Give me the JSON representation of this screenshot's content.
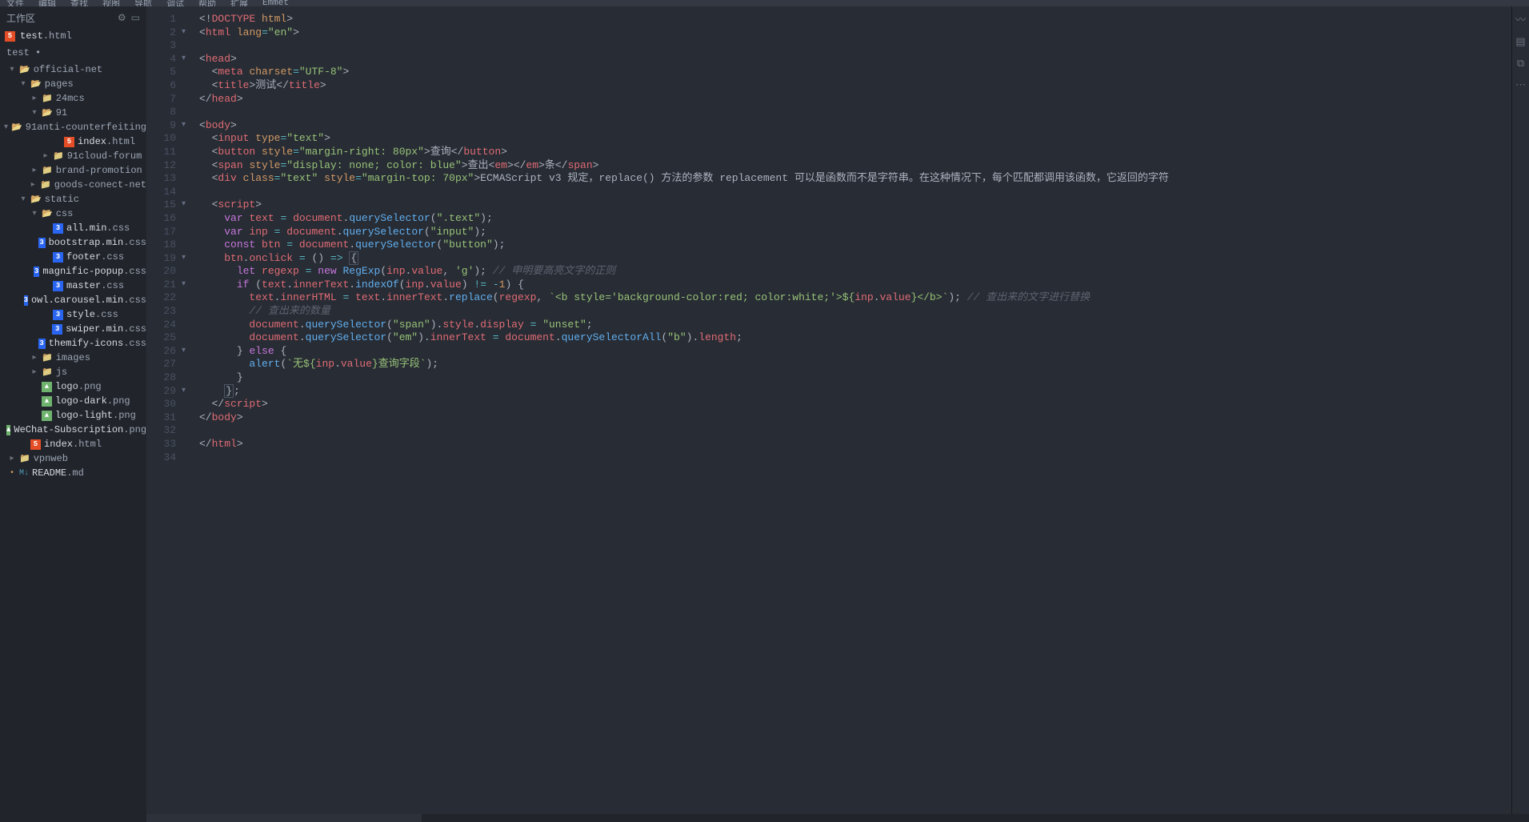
{
  "menubar": [
    "文件",
    "编辑",
    "查找",
    "视图",
    "导航",
    "调试",
    "帮助",
    "扩展",
    "Emmet"
  ],
  "sidebar": {
    "title": "工作区",
    "open_file": {
      "name": "test",
      "ext": ".html"
    },
    "project_root": "test •",
    "tree": [
      {
        "type": "folder",
        "open": true,
        "depth": 0,
        "label": "official-net"
      },
      {
        "type": "folder",
        "open": true,
        "depth": 1,
        "label": "pages"
      },
      {
        "type": "folder",
        "open": false,
        "depth": 2,
        "label": "24mcs"
      },
      {
        "type": "folder",
        "open": true,
        "depth": 2,
        "label": "91"
      },
      {
        "type": "folder",
        "open": true,
        "depth": 3,
        "label": "91anti-counterfeiting"
      },
      {
        "type": "file",
        "icon": "html",
        "depth": 4,
        "label": "index",
        "ext": ".html"
      },
      {
        "type": "folder",
        "open": false,
        "depth": 3,
        "label": "91cloud-forum"
      },
      {
        "type": "folder",
        "open": false,
        "depth": 2,
        "label": "brand-promotion"
      },
      {
        "type": "folder",
        "open": false,
        "depth": 2,
        "label": "goods-conect-net"
      },
      {
        "type": "folder",
        "open": true,
        "depth": 1,
        "label": "static"
      },
      {
        "type": "folder",
        "open": true,
        "depth": 2,
        "label": "css"
      },
      {
        "type": "file",
        "icon": "css",
        "depth": 3,
        "label": "all.min",
        "ext": ".css"
      },
      {
        "type": "file",
        "icon": "css",
        "depth": 3,
        "label": "bootstrap.min",
        "ext": ".css"
      },
      {
        "type": "file",
        "icon": "css",
        "depth": 3,
        "label": "footer",
        "ext": ".css"
      },
      {
        "type": "file",
        "icon": "css",
        "depth": 3,
        "label": "magnific-popup",
        "ext": ".css"
      },
      {
        "type": "file",
        "icon": "css",
        "depth": 3,
        "label": "master",
        "ext": ".css"
      },
      {
        "type": "file",
        "icon": "css",
        "depth": 3,
        "label": "owl.carousel.min",
        "ext": ".css"
      },
      {
        "type": "file",
        "icon": "css",
        "depth": 3,
        "label": "style",
        "ext": ".css"
      },
      {
        "type": "file",
        "icon": "css",
        "depth": 3,
        "label": "swiper.min",
        "ext": ".css"
      },
      {
        "type": "file",
        "icon": "css",
        "depth": 3,
        "label": "themify-icons",
        "ext": ".css"
      },
      {
        "type": "folder",
        "open": false,
        "depth": 2,
        "label": "images"
      },
      {
        "type": "folder",
        "open": false,
        "depth": 2,
        "label": "js"
      },
      {
        "type": "file",
        "icon": "img",
        "depth": 2,
        "label": "logo",
        "ext": ".png"
      },
      {
        "type": "file",
        "icon": "img",
        "depth": 2,
        "label": "logo-dark",
        "ext": ".png"
      },
      {
        "type": "file",
        "icon": "img",
        "depth": 2,
        "label": "logo-light",
        "ext": ".png"
      },
      {
        "type": "file",
        "icon": "img",
        "depth": 2,
        "label": "WeChat-Subscription",
        "ext": ".png"
      },
      {
        "type": "file",
        "icon": "html",
        "depth": 1,
        "label": "index",
        "ext": ".html"
      },
      {
        "type": "folder",
        "open": false,
        "depth": 0,
        "label": "vpnweb"
      },
      {
        "type": "file",
        "icon": "md",
        "depth": 0,
        "label": "README",
        "ext": ".md",
        "bullet": true
      }
    ]
  },
  "editor": {
    "lines": 34,
    "fold_lines": [
      2,
      4,
      9,
      15,
      19,
      21,
      26,
      29
    ],
    "code": [
      [
        [
          "punc",
          "<!"
        ],
        [
          "tag",
          "DOCTYPE"
        ],
        [
          "txt",
          " "
        ],
        [
          "attr",
          "html"
        ],
        [
          "punc",
          ">"
        ]
      ],
      [
        [
          "punc",
          "<"
        ],
        [
          "tag",
          "html"
        ],
        [
          "txt",
          " "
        ],
        [
          "attr",
          "lang"
        ],
        [
          "op",
          "="
        ],
        [
          "str",
          "\"en\""
        ],
        [
          "punc",
          ">"
        ]
      ],
      [],
      [
        [
          "punc",
          "<"
        ],
        [
          "tag",
          "head"
        ],
        [
          "punc",
          ">"
        ]
      ],
      [
        [
          "txt",
          "  "
        ],
        [
          "punc",
          "<"
        ],
        [
          "tag",
          "meta"
        ],
        [
          "txt",
          " "
        ],
        [
          "attr",
          "charset"
        ],
        [
          "op",
          "="
        ],
        [
          "str",
          "\"UTF-8\""
        ],
        [
          "punc",
          ">"
        ]
      ],
      [
        [
          "txt",
          "  "
        ],
        [
          "punc",
          "<"
        ],
        [
          "tag",
          "title"
        ],
        [
          "punc",
          ">"
        ],
        [
          "txt",
          "测试"
        ],
        [
          "punc",
          "</"
        ],
        [
          "tag",
          "title"
        ],
        [
          "punc",
          ">"
        ]
      ],
      [
        [
          "punc",
          "</"
        ],
        [
          "tag",
          "head"
        ],
        [
          "punc",
          ">"
        ]
      ],
      [],
      [
        [
          "punc",
          "<"
        ],
        [
          "tag",
          "body"
        ],
        [
          "punc",
          ">"
        ]
      ],
      [
        [
          "txt",
          "  "
        ],
        [
          "punc",
          "<"
        ],
        [
          "tag",
          "input"
        ],
        [
          "txt",
          " "
        ],
        [
          "attr",
          "type"
        ],
        [
          "op",
          "="
        ],
        [
          "str",
          "\"text\""
        ],
        [
          "punc",
          ">"
        ]
      ],
      [
        [
          "txt",
          "  "
        ],
        [
          "punc",
          "<"
        ],
        [
          "tag",
          "button"
        ],
        [
          "txt",
          " "
        ],
        [
          "attr",
          "style"
        ],
        [
          "op",
          "="
        ],
        [
          "str",
          "\"margin-right: 80px\""
        ],
        [
          "punc",
          ">"
        ],
        [
          "txt",
          "查询"
        ],
        [
          "punc",
          "</"
        ],
        [
          "tag",
          "button"
        ],
        [
          "punc",
          ">"
        ]
      ],
      [
        [
          "txt",
          "  "
        ],
        [
          "punc",
          "<"
        ],
        [
          "tag",
          "span"
        ],
        [
          "txt",
          " "
        ],
        [
          "attr",
          "style"
        ],
        [
          "op",
          "="
        ],
        [
          "str",
          "\"display: none; color: blue\""
        ],
        [
          "punc",
          ">"
        ],
        [
          "txt",
          "查出"
        ],
        [
          "punc",
          "<"
        ],
        [
          "tag",
          "em"
        ],
        [
          "punc",
          ">"
        ],
        [
          "punc",
          "</"
        ],
        [
          "tag",
          "em"
        ],
        [
          "punc",
          ">"
        ],
        [
          "txt",
          "条"
        ],
        [
          "punc",
          "</"
        ],
        [
          "tag",
          "span"
        ],
        [
          "punc",
          ">"
        ]
      ],
      [
        [
          "txt",
          "  "
        ],
        [
          "punc",
          "<"
        ],
        [
          "tag",
          "div"
        ],
        [
          "txt",
          " "
        ],
        [
          "attr",
          "class"
        ],
        [
          "op",
          "="
        ],
        [
          "str",
          "\"text\""
        ],
        [
          "txt",
          " "
        ],
        [
          "attr",
          "style"
        ],
        [
          "op",
          "="
        ],
        [
          "str",
          "\"margin-top: 70px\""
        ],
        [
          "punc",
          ">"
        ],
        [
          "txt",
          "ECMAScript v3 规定，replace() 方法的参数 replacement 可以是函数而不是字符串。在这种情况下，每个匹配都调用该函数，它返回的字符"
        ]
      ],
      [],
      [
        [
          "txt",
          "  "
        ],
        [
          "punc",
          "<"
        ],
        [
          "tag",
          "script"
        ],
        [
          "punc",
          ">"
        ]
      ],
      [
        [
          "txt",
          "    "
        ],
        [
          "kw",
          "var"
        ],
        [
          "txt",
          " "
        ],
        [
          "id",
          "text"
        ],
        [
          "txt",
          " "
        ],
        [
          "op",
          "="
        ],
        [
          "txt",
          " "
        ],
        [
          "id",
          "document"
        ],
        [
          "punc",
          "."
        ],
        [
          "fn",
          "querySelector"
        ],
        [
          "punc",
          "("
        ],
        [
          "str",
          "\".text\""
        ],
        [
          "punc",
          ");"
        ]
      ],
      [
        [
          "txt",
          "    "
        ],
        [
          "kw",
          "var"
        ],
        [
          "txt",
          " "
        ],
        [
          "id",
          "inp"
        ],
        [
          "txt",
          " "
        ],
        [
          "op",
          "="
        ],
        [
          "txt",
          " "
        ],
        [
          "id",
          "document"
        ],
        [
          "punc",
          "."
        ],
        [
          "fn",
          "querySelector"
        ],
        [
          "punc",
          "("
        ],
        [
          "str",
          "\"input\""
        ],
        [
          "punc",
          ");"
        ]
      ],
      [
        [
          "txt",
          "    "
        ],
        [
          "kw",
          "const"
        ],
        [
          "txt",
          " "
        ],
        [
          "id",
          "btn"
        ],
        [
          "txt",
          " "
        ],
        [
          "op",
          "="
        ],
        [
          "txt",
          " "
        ],
        [
          "id",
          "document"
        ],
        [
          "punc",
          "."
        ],
        [
          "fn",
          "querySelector"
        ],
        [
          "punc",
          "("
        ],
        [
          "str",
          "\"button\""
        ],
        [
          "punc",
          ");"
        ]
      ],
      [
        [
          "txt",
          "    "
        ],
        [
          "id",
          "btn"
        ],
        [
          "punc",
          "."
        ],
        [
          "id",
          "onclick"
        ],
        [
          "txt",
          " "
        ],
        [
          "op",
          "="
        ],
        [
          "txt",
          " "
        ],
        [
          "punc",
          "()"
        ],
        [
          "txt",
          " "
        ],
        [
          "op",
          "=>"
        ],
        [
          "txt",
          " "
        ],
        [
          "brace",
          "{"
        ]
      ],
      [
        [
          "txt",
          "      "
        ],
        [
          "kw",
          "let"
        ],
        [
          "txt",
          " "
        ],
        [
          "id",
          "regexp"
        ],
        [
          "txt",
          " "
        ],
        [
          "op",
          "="
        ],
        [
          "txt",
          " "
        ],
        [
          "kw",
          "new"
        ],
        [
          "txt",
          " "
        ],
        [
          "fn",
          "RegExp"
        ],
        [
          "punc",
          "("
        ],
        [
          "id",
          "inp"
        ],
        [
          "punc",
          "."
        ],
        [
          "id",
          "value"
        ],
        [
          "punc",
          ", "
        ],
        [
          "str",
          "'g'"
        ],
        [
          "punc",
          ");"
        ],
        [
          "txt",
          " "
        ],
        [
          "comment",
          "// 申明要高亮文字的正则"
        ]
      ],
      [
        [
          "txt",
          "      "
        ],
        [
          "kw",
          "if"
        ],
        [
          "txt",
          " "
        ],
        [
          "punc",
          "("
        ],
        [
          "id",
          "text"
        ],
        [
          "punc",
          "."
        ],
        [
          "id",
          "innerText"
        ],
        [
          "punc",
          "."
        ],
        [
          "fn",
          "indexOf"
        ],
        [
          "punc",
          "("
        ],
        [
          "id",
          "inp"
        ],
        [
          "punc",
          "."
        ],
        [
          "id",
          "value"
        ],
        [
          "punc",
          ")"
        ],
        [
          "txt",
          " "
        ],
        [
          "op",
          "!="
        ],
        [
          "txt",
          " "
        ],
        [
          "op",
          "-"
        ],
        [
          "num",
          "1"
        ],
        [
          "punc",
          ")"
        ],
        [
          "txt",
          " "
        ],
        [
          "punc",
          "{"
        ]
      ],
      [
        [
          "txt",
          "        "
        ],
        [
          "id",
          "text"
        ],
        [
          "punc",
          "."
        ],
        [
          "id",
          "innerHTML"
        ],
        [
          "txt",
          " "
        ],
        [
          "op",
          "="
        ],
        [
          "txt",
          " "
        ],
        [
          "id",
          "text"
        ],
        [
          "punc",
          "."
        ],
        [
          "id",
          "innerText"
        ],
        [
          "punc",
          "."
        ],
        [
          "fn",
          "replace"
        ],
        [
          "punc",
          "("
        ],
        [
          "id",
          "regexp"
        ],
        [
          "punc",
          ", "
        ],
        [
          "str",
          "`<b style='background-color:red; color:white;'>${"
        ],
        [
          "id",
          "inp"
        ],
        [
          "punc",
          "."
        ],
        [
          "id",
          "value"
        ],
        [
          "str",
          "}</b>`"
        ],
        [
          "punc",
          ");"
        ],
        [
          "txt",
          " "
        ],
        [
          "comment",
          "// 查出来的文字进行替换"
        ]
      ],
      [
        [
          "txt",
          "        "
        ],
        [
          "comment",
          "// 查出来的数量"
        ]
      ],
      [
        [
          "txt",
          "        "
        ],
        [
          "id",
          "document"
        ],
        [
          "punc",
          "."
        ],
        [
          "fn",
          "querySelector"
        ],
        [
          "punc",
          "("
        ],
        [
          "str",
          "\"span\""
        ],
        [
          "punc",
          ")."
        ],
        [
          "id",
          "style"
        ],
        [
          "punc",
          "."
        ],
        [
          "id",
          "display"
        ],
        [
          "txt",
          " "
        ],
        [
          "op",
          "="
        ],
        [
          "txt",
          " "
        ],
        [
          "str",
          "\"unset\""
        ],
        [
          "punc",
          ";"
        ]
      ],
      [
        [
          "txt",
          "        "
        ],
        [
          "id",
          "document"
        ],
        [
          "punc",
          "."
        ],
        [
          "fn",
          "querySelector"
        ],
        [
          "punc",
          "("
        ],
        [
          "str",
          "\"em\""
        ],
        [
          "punc",
          ")."
        ],
        [
          "id",
          "innerText"
        ],
        [
          "txt",
          " "
        ],
        [
          "op",
          "="
        ],
        [
          "txt",
          " "
        ],
        [
          "id",
          "document"
        ],
        [
          "punc",
          "."
        ],
        [
          "fn",
          "querySelectorAll"
        ],
        [
          "punc",
          "("
        ],
        [
          "str",
          "\"b\""
        ],
        [
          "punc",
          ")."
        ],
        [
          "id",
          "length"
        ],
        [
          "punc",
          ";"
        ]
      ],
      [
        [
          "txt",
          "      "
        ],
        [
          "punc",
          "}"
        ],
        [
          "txt",
          " "
        ],
        [
          "kw",
          "else"
        ],
        [
          "txt",
          " "
        ],
        [
          "punc",
          "{"
        ]
      ],
      [
        [
          "txt",
          "        "
        ],
        [
          "fn",
          "alert"
        ],
        [
          "punc",
          "("
        ],
        [
          "str",
          "`无${"
        ],
        [
          "id",
          "inp"
        ],
        [
          "punc",
          "."
        ],
        [
          "id",
          "value"
        ],
        [
          "str",
          "}查询字段`"
        ],
        [
          "punc",
          ");"
        ]
      ],
      [
        [
          "txt",
          "      "
        ],
        [
          "punc",
          "}"
        ]
      ],
      [
        [
          "txt",
          "    "
        ],
        [
          "brace2",
          "}"
        ],
        [
          "punc",
          ";"
        ]
      ],
      [
        [
          "txt",
          "  "
        ],
        [
          "punc",
          "</"
        ],
        [
          "tag",
          "script"
        ],
        [
          "punc",
          ">"
        ]
      ],
      [
        [
          "punc",
          "</"
        ],
        [
          "tag",
          "body"
        ],
        [
          "punc",
          ">"
        ]
      ],
      [],
      [
        [
          "punc",
          "</"
        ],
        [
          "tag",
          "html"
        ],
        [
          "punc",
          ">"
        ]
      ],
      []
    ]
  }
}
